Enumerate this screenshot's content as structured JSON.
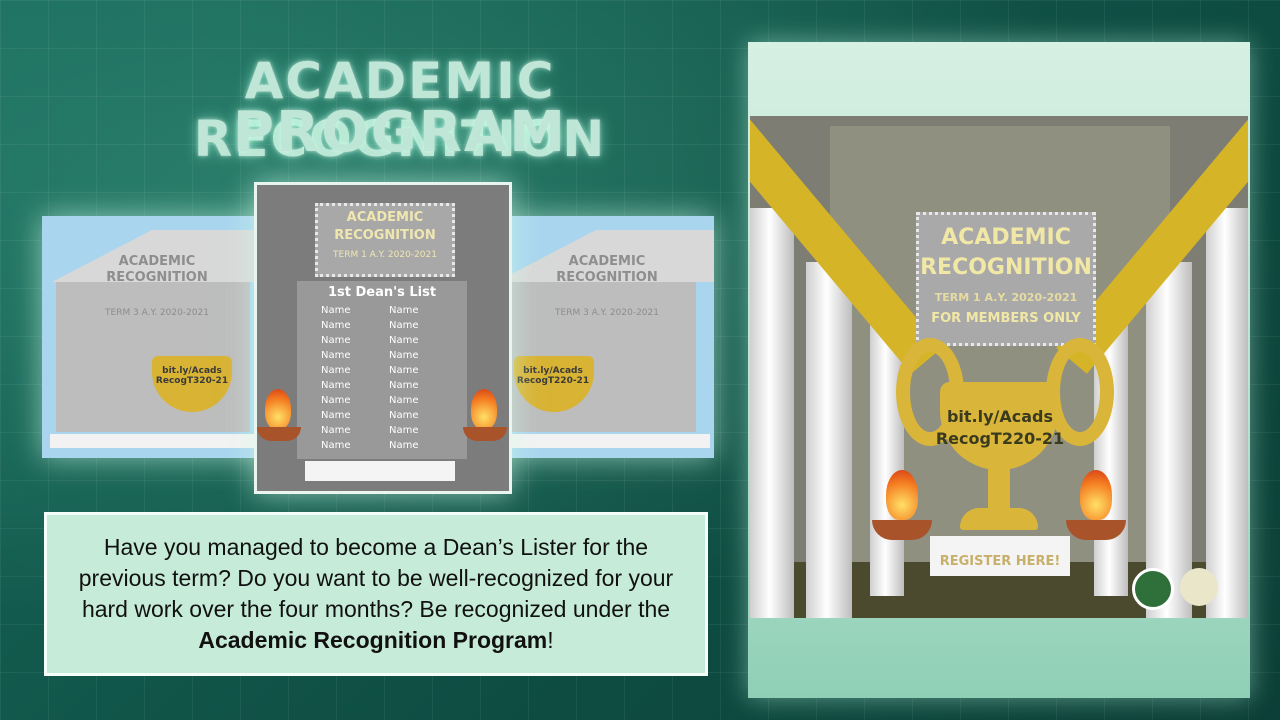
{
  "header": {
    "line1": "ACADEMIC RECOGNITION",
    "line2": "PROGRAM"
  },
  "preview_left": {
    "title_line1": "ACADEMIC",
    "title_line2": "RECOGNITION",
    "subtitle": "TERM 3 A.Y. 2020-2021",
    "cup_url": "bit.ly/Acads\nRecogT320-21"
  },
  "preview_middle": {
    "title_line1": "ACADEMIC",
    "title_line2": "RECOGNITION",
    "subtitle": "TERM 1 A.Y. 2020-2021",
    "list_title": "1st Dean's List",
    "names": [
      "Name",
      "Name",
      "Name",
      "Name",
      "Name",
      "Name",
      "Name",
      "Name",
      "Name",
      "Name",
      "Name",
      "Name",
      "Name",
      "Name",
      "Name",
      "Name",
      "Name",
      "Name",
      "Name",
      "Name"
    ]
  },
  "preview_right": {
    "title_line1": "ACADEMIC",
    "title_line2": "RECOGNITION",
    "subtitle": "TERM 3 A.Y. 2020-2021",
    "cup_url": "bit.ly/Acads\nRecogT220-21"
  },
  "description": {
    "text": "Have you managed to become a Dean’s Lister for the previous term? Do you want to be well-recognized for your hard work over the four months? Be recognized under the ",
    "bold": "Academic Recognition Program",
    "end": "!"
  },
  "poster": {
    "title_line1": "ACADEMIC",
    "title_line2": "RECOGNITION",
    "subtitle": "TERM 1 A.Y. 2020-2021",
    "members": "FOR MEMBERS ONLY",
    "url_line1": "bit.ly/Acads",
    "url_line2": "RecogT220-21",
    "register": "REGISTER HERE!"
  },
  "colors": {
    "background": "#135a4c",
    "title": "#bfe6d6",
    "gold": "#d9b53a",
    "textbox": "#c6ecd9"
  }
}
